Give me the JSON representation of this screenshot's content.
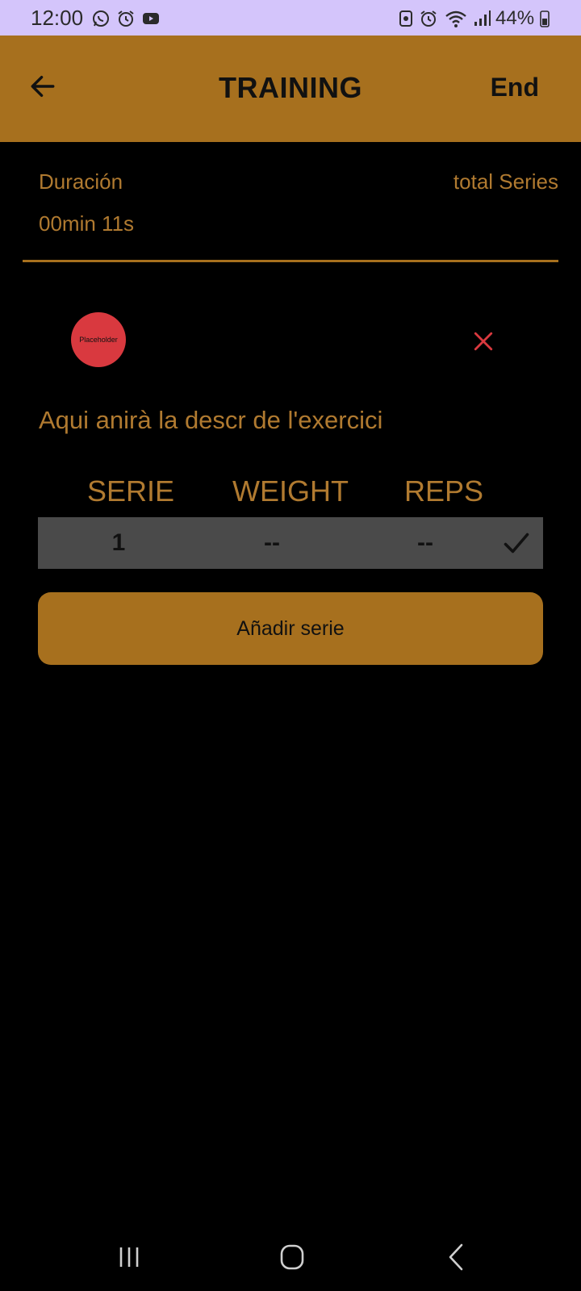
{
  "status_bar": {
    "time": "12:00",
    "battery": "44%",
    "left_icons": [
      "whatsapp-icon",
      "alarm-icon",
      "youtube-icon"
    ],
    "right_icons": [
      "screen-record-icon",
      "alarm-icon",
      "wifi-icon",
      "signal-icon",
      "battery-icon"
    ]
  },
  "app_bar": {
    "title": "TRAINING",
    "end_label": "End",
    "back_icon": "arrow-left-icon"
  },
  "summary": {
    "duration_label": "Duración",
    "duration_value": "00min 11s",
    "total_series_label": "total Series"
  },
  "exercise": {
    "image_placeholder": "Placeholder",
    "description": "Aqui anirà la descr de l'exercici",
    "columns": {
      "serie": "SERIE",
      "weight": "WEIGHT",
      "reps": "REPS"
    },
    "sets": [
      {
        "number": "1",
        "weight": "--",
        "reps": "--"
      }
    ],
    "add_set_label": "Añadir serie"
  },
  "colors": {
    "accent": "#a7701e",
    "accent_text": "#b07a30",
    "background": "#000000",
    "row_background": "#4a4a4a",
    "remove_red": "#d9393f",
    "status_bar_bg": "#d4c5fb"
  },
  "nav_bar": {
    "icons": [
      "recent-apps-icon",
      "home-icon",
      "back-icon"
    ]
  }
}
